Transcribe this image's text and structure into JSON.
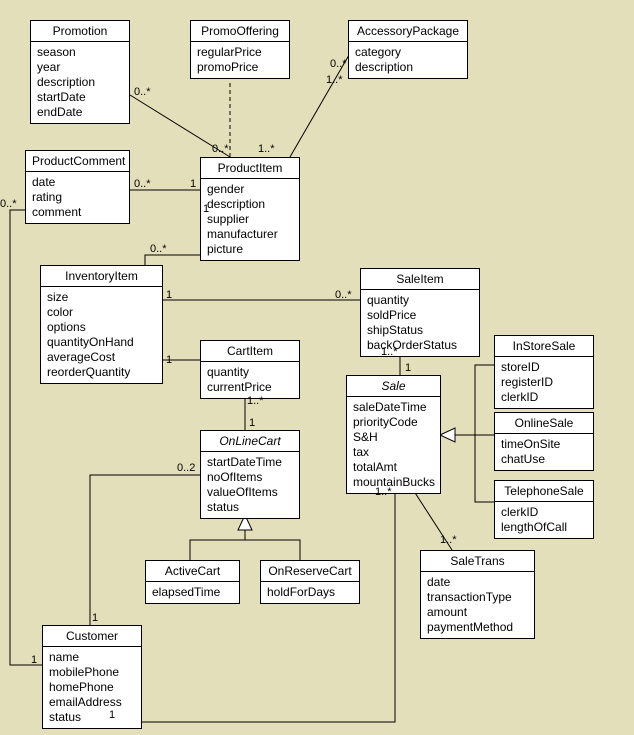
{
  "classes": {
    "promotion": {
      "name": "Promotion",
      "attrs": [
        "season",
        "year",
        "description",
        "startDate",
        "endDate"
      ]
    },
    "promoOffering": {
      "name": "PromoOffering",
      "attrs": [
        "regularPrice",
        "promoPrice"
      ]
    },
    "accessoryPackage": {
      "name": "AccessoryPackage",
      "attrs": [
        "category",
        "description"
      ]
    },
    "productComment": {
      "name": "ProductComment",
      "attrs": [
        "date",
        "rating",
        "comment"
      ]
    },
    "productItem": {
      "name": "ProductItem",
      "attrs": [
        "gender",
        "description",
        "supplier",
        "manufacturer",
        "picture"
      ]
    },
    "inventoryItem": {
      "name": "InventoryItem",
      "attrs": [
        "size",
        "color",
        "options",
        "quantityOnHand",
        "averageCost",
        "reorderQuantity"
      ]
    },
    "saleItem": {
      "name": "SaleItem",
      "attrs": [
        "quantity",
        "soldPrice",
        "shipStatus",
        "backOrderStatus"
      ]
    },
    "cartItem": {
      "name": "CartItem",
      "attrs": [
        "quantity",
        "currentPrice"
      ]
    },
    "sale": {
      "name": "Sale",
      "abstract": true,
      "attrs": [
        "saleDateTime",
        "priorityCode",
        "S&H",
        "tax",
        "totalAmt",
        "mountainBucks"
      ]
    },
    "inStoreSale": {
      "name": "InStoreSale",
      "attrs": [
        "storeID",
        "registerID",
        "clerkID"
      ]
    },
    "onlineSale": {
      "name": "OnlineSale",
      "attrs": [
        "timeOnSite",
        "chatUse"
      ]
    },
    "telephoneSale": {
      "name": "TelephoneSale",
      "attrs": [
        "clerkID",
        "lengthOfCall"
      ]
    },
    "onLineCart": {
      "name": "OnLineCart",
      "abstract": true,
      "attrs": [
        "startDateTime",
        "noOfItems",
        "valueOfItems",
        "status"
      ]
    },
    "activeCart": {
      "name": "ActiveCart",
      "attrs": [
        "elapsedTime"
      ]
    },
    "onReserveCart": {
      "name": "OnReserveCart",
      "attrs": [
        "holdForDays"
      ]
    },
    "saleTrans": {
      "name": "SaleTrans",
      "attrs": [
        "date",
        "transactionType",
        "amount",
        "paymentMethod"
      ]
    },
    "customer": {
      "name": "Customer",
      "attrs": [
        "name",
        "mobilePhone",
        "homePhone",
        "emailAddress",
        "status"
      ]
    }
  },
  "mult": {
    "m1": "0..*",
    "m2": "0..*",
    "m3": "1..*",
    "m4": "0..*",
    "m5": "1..*",
    "m6": "0..*",
    "m7": "1",
    "m8": "0..*",
    "m9": "1",
    "m10": "1",
    "m11": "0..*",
    "m12": "1",
    "m13": "0..*",
    "m14": "1",
    "m15": "1..*",
    "m16": "1..*",
    "m17": "1",
    "m18": "0..2",
    "m19": "1..*",
    "m20": "1..*",
    "m21": "1",
    "m22": "1",
    "m23": "1"
  },
  "chart_data": {
    "type": "uml_class_diagram",
    "classes": [
      {
        "name": "Promotion",
        "attributes": [
          "season",
          "year",
          "description",
          "startDate",
          "endDate"
        ]
      },
      {
        "name": "PromoOffering",
        "attributes": [
          "regularPrice",
          "promoPrice"
        ]
      },
      {
        "name": "AccessoryPackage",
        "attributes": [
          "category",
          "description"
        ]
      },
      {
        "name": "ProductComment",
        "attributes": [
          "date",
          "rating",
          "comment"
        ]
      },
      {
        "name": "ProductItem",
        "attributes": [
          "gender",
          "description",
          "supplier",
          "manufacturer",
          "picture"
        ]
      },
      {
        "name": "InventoryItem",
        "attributes": [
          "size",
          "color",
          "options",
          "quantityOnHand",
          "averageCost",
          "reorderQuantity"
        ]
      },
      {
        "name": "SaleItem",
        "attributes": [
          "quantity",
          "soldPrice",
          "shipStatus",
          "backOrderStatus"
        ]
      },
      {
        "name": "CartItem",
        "attributes": [
          "quantity",
          "currentPrice"
        ]
      },
      {
        "name": "Sale",
        "abstract": true,
        "attributes": [
          "saleDateTime",
          "priorityCode",
          "S&H",
          "tax",
          "totalAmt",
          "mountainBucks"
        ]
      },
      {
        "name": "InStoreSale",
        "attributes": [
          "storeID",
          "registerID",
          "clerkID"
        ]
      },
      {
        "name": "OnlineSale",
        "attributes": [
          "timeOnSite",
          "chatUse"
        ]
      },
      {
        "name": "TelephoneSale",
        "attributes": [
          "clerkID",
          "lengthOfCall"
        ]
      },
      {
        "name": "OnLineCart",
        "abstract": true,
        "attributes": [
          "startDateTime",
          "noOfItems",
          "valueOfItems",
          "status"
        ]
      },
      {
        "name": "ActiveCart",
        "attributes": [
          "elapsedTime"
        ]
      },
      {
        "name": "OnReserveCart",
        "attributes": [
          "holdForDays"
        ]
      },
      {
        "name": "SaleTrans",
        "attributes": [
          "date",
          "transactionType",
          "amount",
          "paymentMethod"
        ]
      },
      {
        "name": "Customer",
        "attributes": [
          "name",
          "mobilePhone",
          "homePhone",
          "emailAddress",
          "status"
        ]
      }
    ],
    "associations": [
      {
        "from": "Promotion",
        "to": "PromoOffering",
        "fromMult": "0..*",
        "toMult": "0..*",
        "associationClass": true
      },
      {
        "from": "PromoOffering",
        "to": "ProductItem",
        "style": "dashed"
      },
      {
        "from": "AccessoryPackage",
        "to": "ProductItem",
        "fromMult": "0..*",
        "toMult": "1..*"
      },
      {
        "from": "ProductComment",
        "to": "ProductItem",
        "fromMult": "0..*",
        "toMult": "1"
      },
      {
        "from": "ProductComment",
        "to": "Customer",
        "fromMult": "0..*",
        "toMult": "1"
      },
      {
        "from": "ProductItem",
        "to": "InventoryItem",
        "fromMult": "1",
        "toMult": "0..*"
      },
      {
        "from": "InventoryItem",
        "to": "SaleItem",
        "fromMult": "1",
        "toMult": "0..*"
      },
      {
        "from": "InventoryItem",
        "to": "CartItem",
        "fromMult": "1",
        "toMult": "0..*"
      },
      {
        "from": "Sale",
        "to": "SaleItem",
        "fromMult": "1",
        "toMult": "1..*"
      },
      {
        "from": "OnLineCart",
        "to": "CartItem",
        "fromMult": "1",
        "toMult": "1..*"
      },
      {
        "from": "Customer",
        "to": "OnLineCart",
        "fromMult": "1",
        "toMult": "0..2"
      },
      {
        "from": "Customer",
        "to": "Sale",
        "fromMult": "1",
        "toMult": "1..*"
      },
      {
        "from": "Sale",
        "to": "SaleTrans",
        "fromMult": "1..*",
        "toMult": "1..*"
      }
    ],
    "generalizations": [
      {
        "parent": "OnLineCart",
        "children": [
          "ActiveCart",
          "OnReserveCart"
        ]
      },
      {
        "parent": "Sale",
        "children": [
          "InStoreSale",
          "OnlineSale",
          "TelephoneSale"
        ]
      }
    ]
  }
}
